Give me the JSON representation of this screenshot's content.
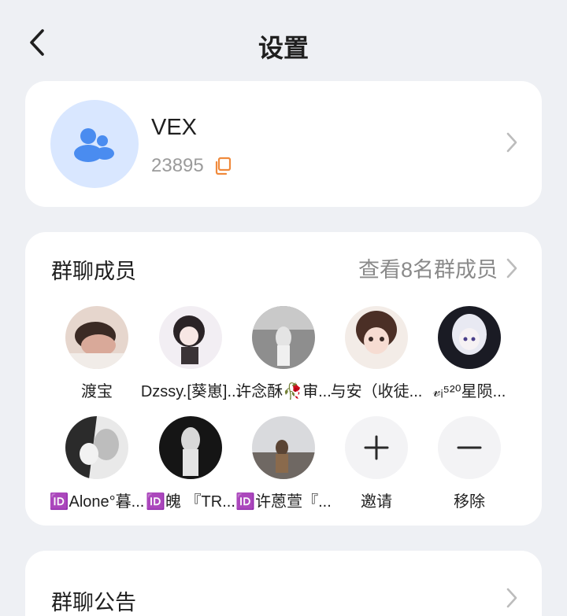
{
  "header": {
    "title": "设置"
  },
  "group": {
    "name": "VEX",
    "id": "23895"
  },
  "members": {
    "section_title": "群聊成员",
    "view_all_label": "查看8名群成员",
    "list": [
      {
        "name": "渡宝",
        "avatar_color": "#c9a89a"
      },
      {
        "name": "Dzssy.[葵崽]...",
        "avatar_color": "#e9e4ea"
      },
      {
        "name": "许念酥🥀审...",
        "avatar_color": "#9a9a9a"
      },
      {
        "name": "与安（收徒...",
        "avatar_color": "#d8c5bf"
      },
      {
        "name": "𝓋ᵢ⁵²⁰星陨...",
        "avatar_color": "#2b2d3a"
      },
      {
        "name": "🆔Alone°暮...",
        "avatar_color": "#cfcfcf"
      },
      {
        "name": "🆔魄 『TR...",
        "avatar_color": "#1b1b1b"
      },
      {
        "name": "🆔许蒽萱『...",
        "avatar_color": "#7b7570"
      }
    ],
    "invite_label": "邀请",
    "remove_label": "移除"
  },
  "notice": {
    "section_title": "群聊公告"
  },
  "colors": {
    "accent_orange": "#f08a3c",
    "group_icon_blue": "#4a8cf0"
  }
}
